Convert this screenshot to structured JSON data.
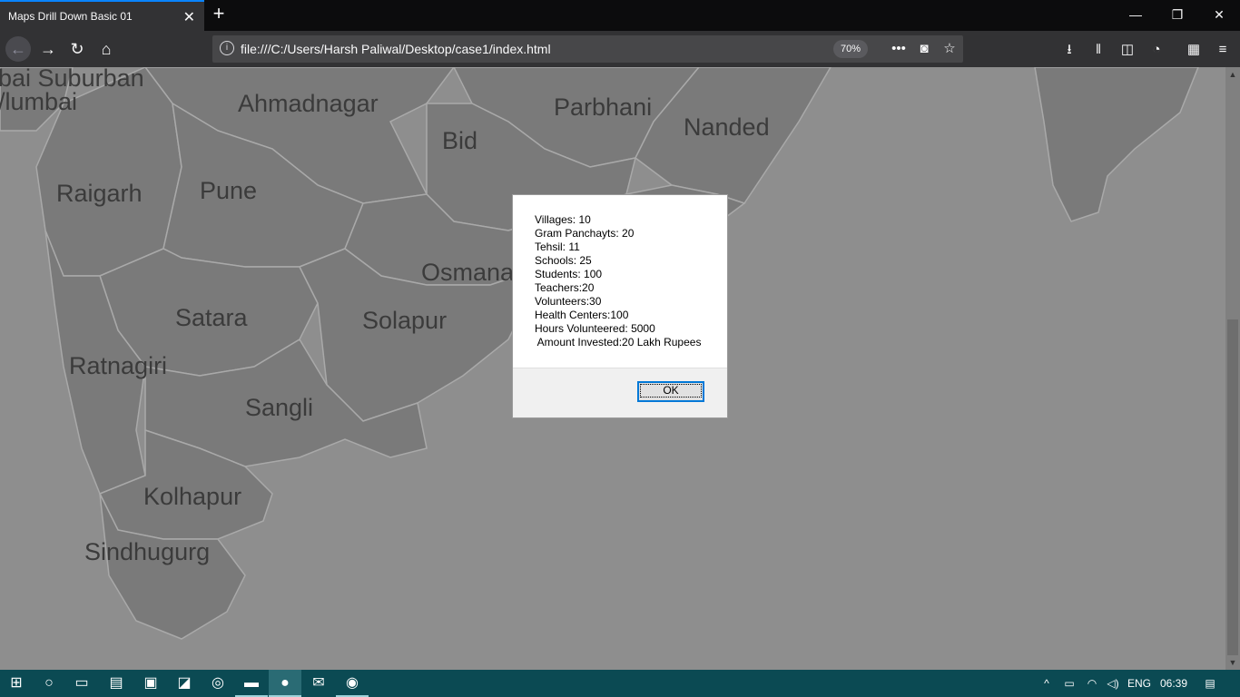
{
  "browser": {
    "tab_title": "Maps Drill Down Basic 01",
    "tab_close": "✕",
    "new_tab": "+",
    "url": "file:///C:/Users/Harsh Paliwal/Desktop/case1/index.html",
    "zoom": "70%",
    "page_actions": "•••"
  },
  "map": {
    "labels": [
      {
        "text": "bai Suburban"
      },
      {
        "text": "/lumbai"
      },
      {
        "text": "Ahmadnagar"
      },
      {
        "text": "Parbhani"
      },
      {
        "text": "Nanded"
      },
      {
        "text": "Bid"
      },
      {
        "text": "Raigarh"
      },
      {
        "text": "Pune"
      },
      {
        "text": "Osmana"
      },
      {
        "text": "Satara"
      },
      {
        "text": "Solapur"
      },
      {
        "text": "Ratnagiri"
      },
      {
        "text": "Sangli"
      },
      {
        "text": "Kolhapur"
      },
      {
        "text": "Sindhugurg"
      }
    ]
  },
  "dialog": {
    "lines": [
      "Villages: 10",
      "Gram Panchayts: 20",
      "Tehsil: 11",
      "Schools: 25",
      "Students: 100",
      "Teachers:20",
      "Volunteers:30",
      "Health Centers:100",
      "Hours Volunteered: 5000",
      " Amount Invested:20 Lakh Rupees"
    ],
    "ok_label": "OK"
  },
  "taskbar": {
    "language": "ENG",
    "time": "06:39"
  },
  "colors": {
    "map_fill": "#7a7a7a",
    "map_background": "#8e8e8e",
    "accent": "#0a84ff",
    "taskbar": "#0b4a53"
  }
}
